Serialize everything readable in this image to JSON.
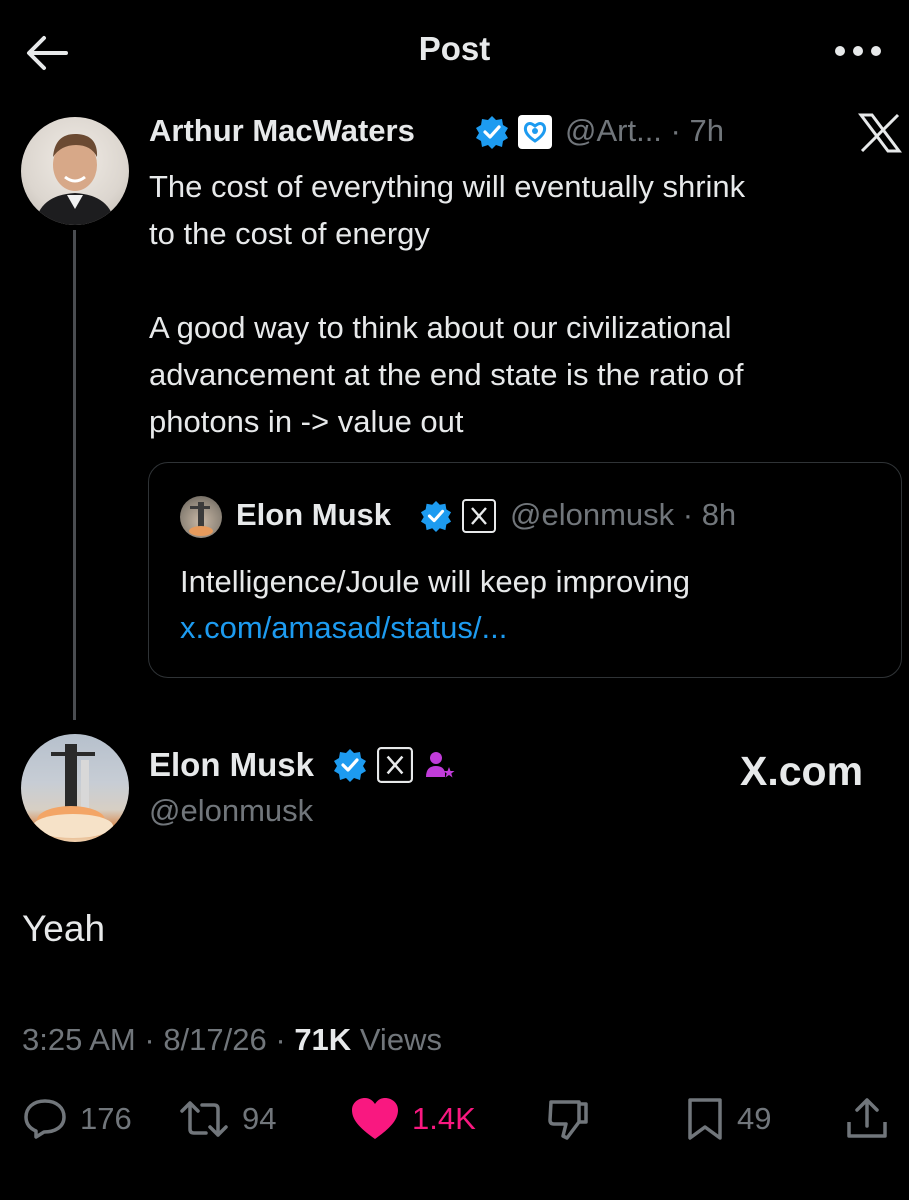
{
  "header": {
    "title": "Post",
    "back_icon": "arrow-left-icon",
    "more_icon": "more-horizontal-icon"
  },
  "parent_post": {
    "author_name": "Arthur MacWaters",
    "handle_time": "@Art... · 7h",
    "badges": [
      "verified-badge-icon",
      "heart-badge-icon"
    ],
    "text_lines_1": "The cost of everything will eventually shrink",
    "text_lines_2": "to the cost of energy",
    "text_lines_3": "A good way to think about our civilizational",
    "text_lines_4": "advancement at the end state is the ratio of",
    "text_lines_5": "photons in -> value out",
    "source_icon": "x-logo-icon"
  },
  "quoted_post": {
    "author_name": "Elon Musk",
    "handle_time": "@elonmusk · 8h",
    "text": "Intelligence/Joule will keep improving",
    "link": "x.com/amasad/status/..."
  },
  "main_post": {
    "author_name": "Elon Musk",
    "handle": "@elonmusk",
    "watermark": "X.com",
    "text": "Yeah",
    "time": "3:25 AM",
    "date": "8/17/26",
    "views_count": "71K",
    "views_label": "Views"
  },
  "actions": {
    "replies": "176",
    "reposts": "94",
    "likes": "1.4K",
    "bookmarks": "49"
  },
  "colors": {
    "background": "#000000",
    "text": "#e7e9ea",
    "muted": "#71767b",
    "link": "#1d9bf0",
    "like": "#f91880",
    "verified": "#1d9bf0",
    "subscriber": "#c13cd9"
  }
}
